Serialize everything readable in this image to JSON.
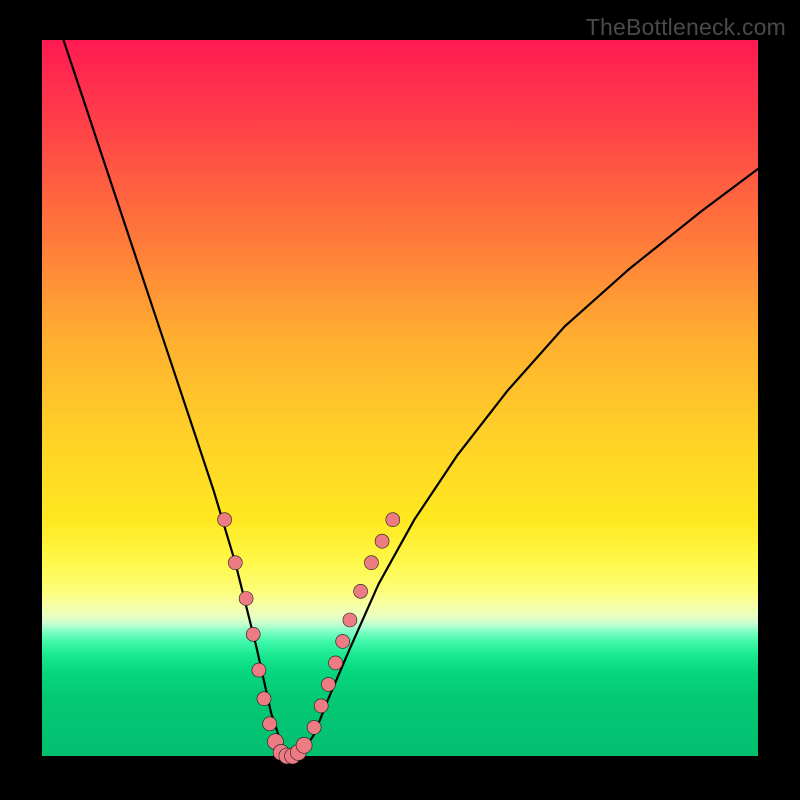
{
  "watermark": "TheBottleneck.com",
  "colors": {
    "background": "#000000",
    "curve_stroke": "#000000",
    "marker_fill": "#ed7b84",
    "marker_stroke": "#1a1a1a"
  },
  "chart_data": {
    "type": "line",
    "title": "",
    "xlabel": "",
    "ylabel": "",
    "xlim": [
      0,
      100
    ],
    "ylim": [
      0,
      100
    ],
    "note": "V-shaped bottleneck curve. Y is rendered inverted (low value at bottom). Curve minimum ~0 near x≈34. Values are visual estimates from the figure.",
    "series": [
      {
        "name": "bottleneck-curve",
        "x": [
          0,
          3,
          6,
          9,
          12,
          15,
          18,
          21,
          24,
          27,
          30,
          32,
          34,
          36,
          38,
          40,
          43,
          47,
          52,
          58,
          65,
          73,
          82,
          92,
          100
        ],
        "y": [
          108,
          100,
          91,
          82,
          73,
          64,
          55,
          46,
          37,
          27,
          15,
          6,
          0,
          0,
          3,
          8,
          15,
          24,
          33,
          42,
          51,
          60,
          68,
          76,
          82
        ]
      }
    ],
    "markers": {
      "name": "highlighted-points",
      "x": [
        25.5,
        27.0,
        28.5,
        29.5,
        30.3,
        31.0,
        31.8,
        32.6,
        33.4,
        34.2,
        35.0,
        35.8,
        36.6,
        38.0,
        39.0,
        40.0,
        41.0,
        42.0,
        43.0,
        44.5,
        46.0,
        47.5,
        49.0
      ],
      "y": [
        33.0,
        27.0,
        22.0,
        17.0,
        12.0,
        8.0,
        4.5,
        2.0,
        0.5,
        0.0,
        0.0,
        0.5,
        1.5,
        4.0,
        7.0,
        10.0,
        13.0,
        16.0,
        19.0,
        23.0,
        27.0,
        30.0,
        33.0
      ]
    }
  }
}
